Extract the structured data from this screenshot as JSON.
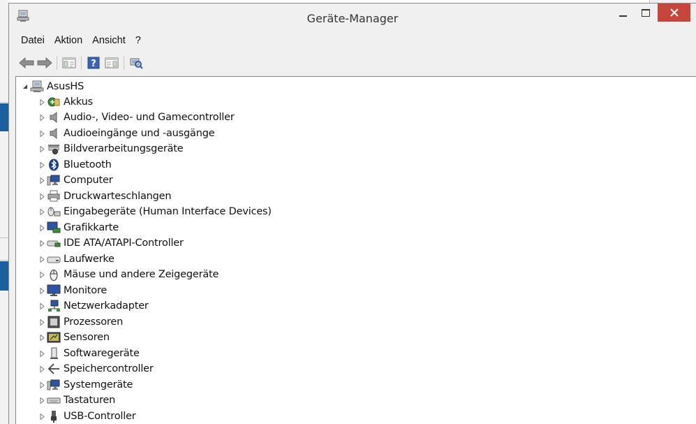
{
  "window": {
    "title": "Geräte-Manager"
  },
  "menu": [
    "Datei",
    "Aktion",
    "Ansicht",
    "?"
  ],
  "toolbar": {
    "buttons": [
      "back-icon",
      "forward-icon",
      "show-hide-console-tree-icon",
      "help-icon",
      "action-pane-icon",
      "scan-hardware-icon"
    ]
  },
  "tree": {
    "root": {
      "label": "AsusHS",
      "icon": "computer-root-icon",
      "expanded": true
    },
    "items": [
      {
        "label": "Akkus",
        "icon": "battery-icon"
      },
      {
        "label": "Audio-, Video- und Gamecontroller",
        "icon": "speaker-icon"
      },
      {
        "label": "Audioeingänge und -ausgänge",
        "icon": "speaker-icon"
      },
      {
        "label": "Bildverarbeitungsgeräte",
        "icon": "scanner-camera-icon"
      },
      {
        "label": "Bluetooth",
        "icon": "bluetooth-icon"
      },
      {
        "label": "Computer",
        "icon": "computer-icon"
      },
      {
        "label": "Druckwarteschlangen",
        "icon": "printer-icon"
      },
      {
        "label": "Eingabegeräte (Human Interface Devices)",
        "icon": "hid-icon"
      },
      {
        "label": "Grafikkarte",
        "icon": "display-adapter-icon"
      },
      {
        "label": "IDE ATA/ATAPI-Controller",
        "icon": "ide-controller-icon"
      },
      {
        "label": "Laufwerke",
        "icon": "disk-drive-icon"
      },
      {
        "label": "Mäuse und andere Zeigegeräte",
        "icon": "mouse-icon"
      },
      {
        "label": "Monitore",
        "icon": "monitor-icon"
      },
      {
        "label": "Netzwerkadapter",
        "icon": "network-adapter-icon"
      },
      {
        "label": "Prozessoren",
        "icon": "processor-icon"
      },
      {
        "label": "Sensoren",
        "icon": "sensor-icon"
      },
      {
        "label": "Softwaregeräte",
        "icon": "software-device-icon"
      },
      {
        "label": "Speichercontroller",
        "icon": "storage-controller-icon"
      },
      {
        "label": "Systemgeräte",
        "icon": "system-device-icon"
      },
      {
        "label": "Tastaturen",
        "icon": "keyboard-icon"
      },
      {
        "label": "USB-Controller",
        "icon": "usb-icon"
      }
    ]
  },
  "colors": {
    "close_button": "#c7453b",
    "chrome": "#f0f0f0",
    "desktop_accent": "#1d5f9e"
  }
}
